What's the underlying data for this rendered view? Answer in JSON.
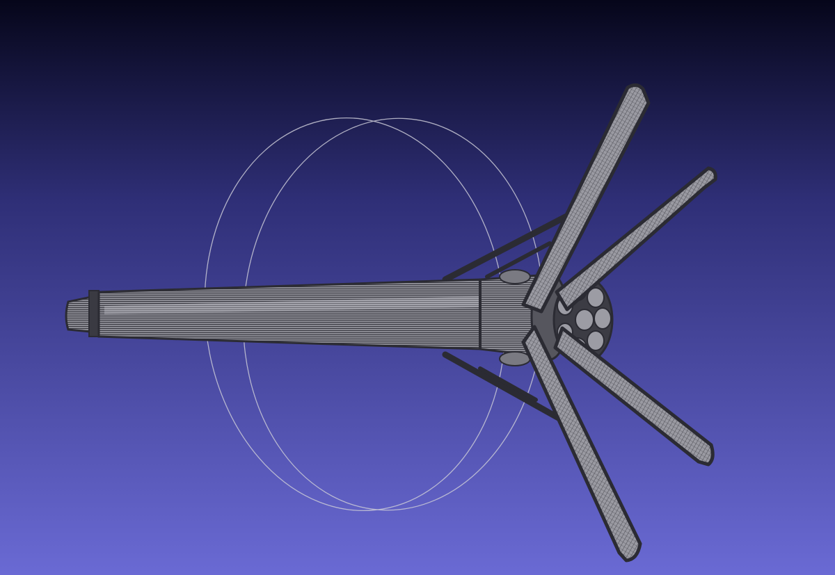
{
  "viewport": {
    "background_top": "#06061a",
    "background_mid": "#2f2f77",
    "background_bottom": "#6a6ad4"
  },
  "model": {
    "wire_dark": "#2b2b33",
    "wire_light": "#e0e0e4",
    "body_fill": "#7d7d86",
    "trackball_color": "#c9c9d6"
  }
}
